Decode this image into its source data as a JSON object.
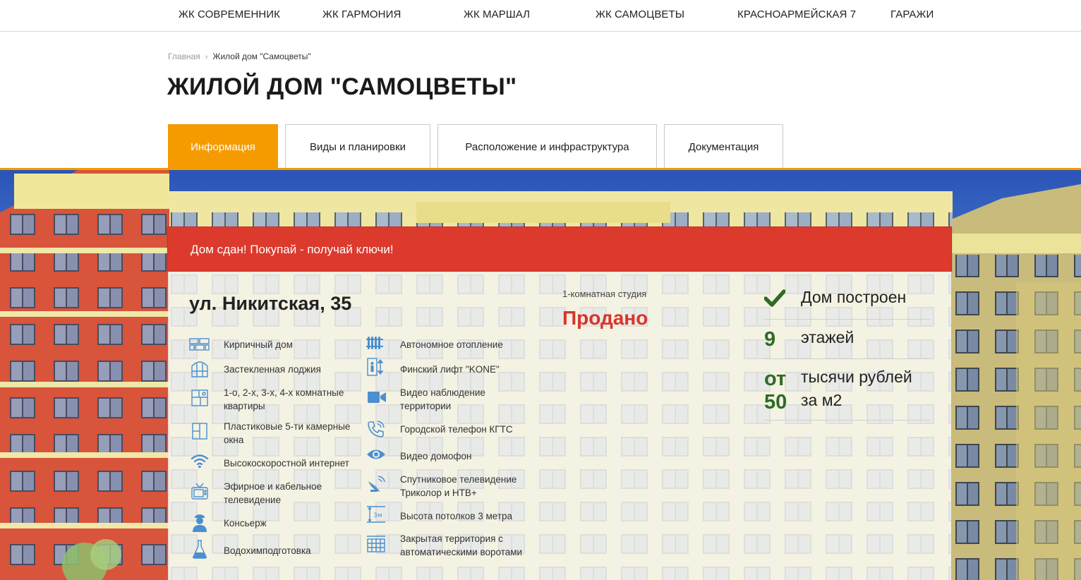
{
  "nav": {
    "items": [
      "ЖК СОВРЕМЕННИК",
      "ЖК ГАРМОНИЯ",
      "ЖК МАРШАЛ",
      "ЖК САМОЦВЕТЫ",
      "КРАСНОАРМЕЙСКАЯ 7",
      "ГАРАЖИ"
    ]
  },
  "breadcrumb": {
    "home": "Главная",
    "separator": "›",
    "current": "Жилой дом \"Самоцветы\""
  },
  "page_title": "ЖИЛОЙ ДОМ \"САМОЦВЕТЫ\"",
  "tabs": [
    {
      "label": "Информация",
      "active": true
    },
    {
      "label": "Виды и планировки",
      "active": false
    },
    {
      "label": "Расположение и инфраструктура",
      "active": false
    },
    {
      "label": "Документация",
      "active": false
    }
  ],
  "banner": {
    "text": "Дом сдан! Покупай - получай ключи!",
    "color": "#dc3a2d"
  },
  "address": "ул. Никитская, 35",
  "features_left": [
    {
      "icon": "brick-icon",
      "text": "Кирпичный дом"
    },
    {
      "icon": "loggia-icon",
      "text": "Застекленная лоджия"
    },
    {
      "icon": "floorplan-icon",
      "text": "1-о, 2-х, 3-х, 4-х комнатные квартиры"
    },
    {
      "icon": "window-icon",
      "text": "Пластиковые 5-ти камерные окна"
    },
    {
      "icon": "wifi-icon",
      "text": "Высокоскоростной интернет"
    },
    {
      "icon": "tv-icon",
      "text": "Эфирное и кабельное телевидение"
    },
    {
      "icon": "concierge-icon",
      "text": "Консьерж"
    },
    {
      "icon": "flask-icon",
      "text": "Водохимподготовка"
    }
  ],
  "features_right": [
    {
      "icon": "radiator-icon",
      "text": "Автономное отопление"
    },
    {
      "icon": "elevator-icon",
      "text": "Финский лифт \"KONE\""
    },
    {
      "icon": "camera-icon",
      "text": "Видео наблюдение территории"
    },
    {
      "icon": "phone-icon",
      "text": "Городской телефон КГТС"
    },
    {
      "icon": "eye-icon",
      "text": "Видео домофон"
    },
    {
      "icon": "satellite-icon",
      "text": "Спутниковое телевидение Триколор и НТВ+"
    },
    {
      "icon": "ceiling-height-icon",
      "text": "Высота потолков 3 метра"
    },
    {
      "icon": "gate-icon",
      "text": "Закрытая территория с автоматическими воротами"
    }
  ],
  "offer": {
    "type": "1-комнатная студия",
    "status": "Продано"
  },
  "stats": {
    "built": "Дом построен",
    "floors_num": "9",
    "floors_label": "этажей",
    "price_prefix": "от",
    "price_num": "50",
    "price_label_1": "тысячи рублей",
    "price_label_2": "за м2"
  },
  "colors": {
    "accent": "#f59b00",
    "banner": "#dc3a2d",
    "sold": "#d9342a",
    "stat_green": "#2e6b25",
    "icon_blue": "#4a8fd0"
  }
}
